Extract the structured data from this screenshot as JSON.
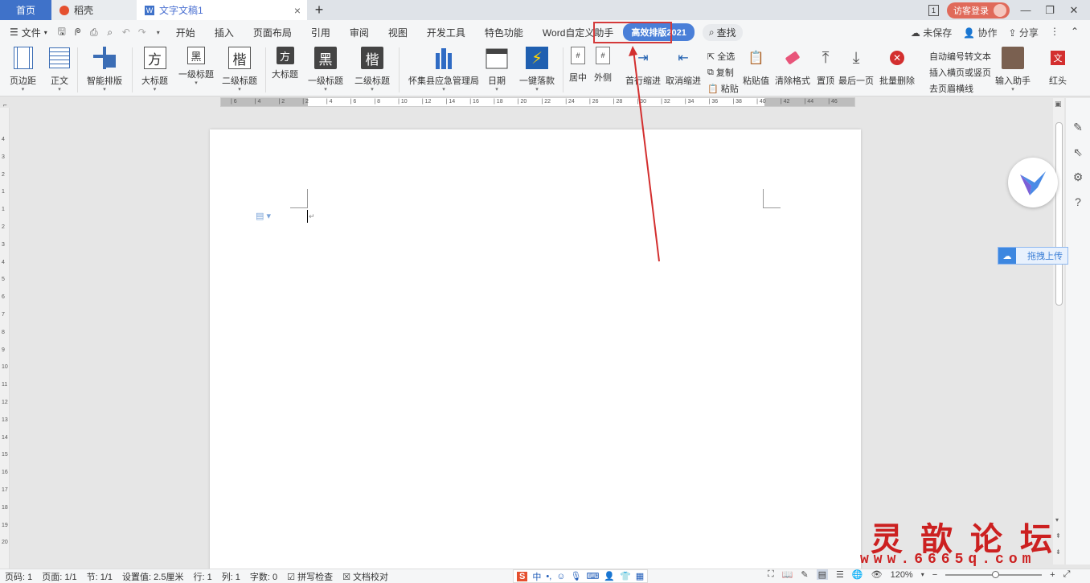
{
  "titlebar": {
    "tab_home": "首页",
    "tab_daoke": "稻壳",
    "tab_doc": "文字文稿1",
    "new_tab": "+",
    "badge": "1",
    "login": "访客登录",
    "win_min": "—",
    "win_max": "❐",
    "win_close": "✕"
  },
  "menubar": {
    "file": "文件",
    "tabs": [
      "开始",
      "插入",
      "页面布局",
      "引用",
      "审阅",
      "视图",
      "开发工具",
      "特色功能",
      "Word自定义助手"
    ],
    "active_tab": "高效排版2021",
    "search": "查找",
    "unsaved": "未保存",
    "collab": "协作",
    "share": "分享"
  },
  "ribbon": {
    "page_margin": "页边距",
    "body_text": "正文",
    "smart_layout": "智能排版",
    "big_title": "大标题",
    "h1": "一级标题",
    "h2": "二级标题",
    "big_title_b": "大标题",
    "h1_b": "一级标题",
    "h2_b": "二级标题",
    "glyph_fang": "方",
    "glyph_hei": "黑",
    "glyph_kai": "楷",
    "agency": "怀集县应急管理局",
    "date": "日期",
    "one_key": "一键落款",
    "center": "居中",
    "outside": "外侧",
    "first_indent": "首行缩进",
    "cancel_indent": "取消缩进",
    "select_all": "全选",
    "copy": "复制",
    "paste": "粘贴",
    "paste_value": "粘贴值",
    "clear_format": "清除格式",
    "top": "置顶",
    "last_page": "最后一页",
    "batch_delete": "批量删除",
    "auto_number": "自动编号转文本",
    "insert_landscape": "插入横页或竖页",
    "remove_header_line": "去页眉横线",
    "input_helper": "输入助手",
    "red_head": "红头",
    "wen": "文"
  },
  "ruler_labels": [
    "6",
    "4",
    "2",
    "2",
    "4",
    "6",
    "8",
    "10",
    "12",
    "14",
    "16",
    "18",
    "20",
    "22",
    "24",
    "26",
    "28",
    "30",
    "32",
    "34",
    "36",
    "38",
    "40",
    "42",
    "44",
    "46"
  ],
  "vruler_labels": [
    "4",
    "3",
    "2",
    "1",
    "1",
    "2",
    "3",
    "4",
    "5",
    "6",
    "7",
    "8",
    "9",
    "10",
    "11",
    "12",
    "13",
    "14",
    "15",
    "16",
    "17",
    "18",
    "19",
    "20"
  ],
  "upload_label": "拖拽上传",
  "status": {
    "page_num": "页码: 1",
    "pages": "页面: 1/1",
    "section": "节: 1/1",
    "setting": "设置值: 2.5厘米",
    "row": "行: 1",
    "col": "列: 1",
    "words": "字数: 0",
    "spell": "拼写检查",
    "proof": "文档校对",
    "zoom": "120%"
  },
  "ime": {
    "s": "S",
    "mode": "中"
  },
  "watermark": {
    "cn": "灵歆论坛",
    "url": "www.6665q.com"
  }
}
